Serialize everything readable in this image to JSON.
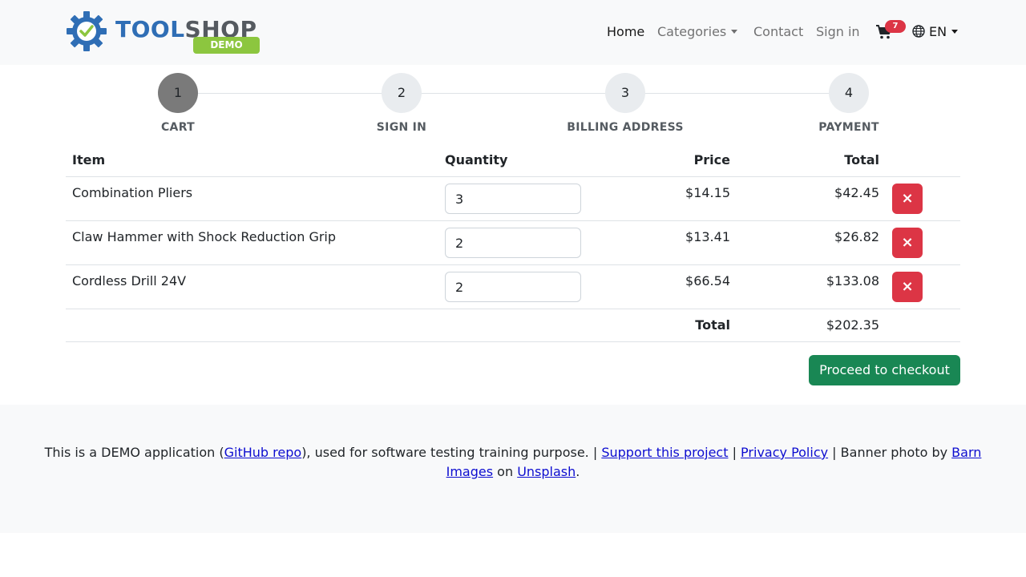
{
  "navbar": {
    "brand": {
      "word_part1": "TOOL",
      "word_part2": "SHOP",
      "badge": "DEMO"
    },
    "links": {
      "home": "Home",
      "categories": "Categories",
      "contact": "Contact",
      "sign_in": "Sign in"
    },
    "cart": {
      "icon": "cart-icon",
      "count": "7"
    },
    "language": {
      "icon": "globe-icon",
      "value": "EN"
    }
  },
  "stepper": {
    "steps": [
      {
        "number": "1",
        "label": "CART",
        "current": true
      },
      {
        "number": "2",
        "label": "SIGN IN",
        "current": false
      },
      {
        "number": "3",
        "label": "BILLING ADDRESS",
        "current": false
      },
      {
        "number": "4",
        "label": "PAYMENT",
        "current": false
      }
    ]
  },
  "cart_table": {
    "headers": {
      "item": "Item",
      "quantity": "Quantity",
      "price": "Price",
      "total": "Total"
    },
    "rows": [
      {
        "item": "Combination Pliers",
        "quantity": "3",
        "price": "$14.15",
        "total": "$42.45"
      },
      {
        "item": "Claw Hammer with Shock Reduction Grip",
        "quantity": "2",
        "price": "$13.41",
        "total": "$26.82"
      },
      {
        "item": "Cordless Drill 24V",
        "quantity": "2",
        "price": "$66.54",
        "total": "$133.08"
      }
    ],
    "delete_icon": "×",
    "summary": {
      "label": "Total",
      "value": "$202.35"
    }
  },
  "checkout_button": "Proceed to checkout",
  "footer": {
    "t1": "This is a DEMO application (",
    "github_link": "GitHub repo",
    "t2": "), used for software testing training purpose. | ",
    "support_link": "Support this project",
    "t3": " | ",
    "privacy_link": "Privacy Policy",
    "t4": " | Banner photo by ",
    "barn_link": "Barn Images",
    "t5": " on ",
    "unsplash_link": "Unsplash",
    "t6": "."
  },
  "colors": {
    "danger": "#dc3545",
    "success": "#198754",
    "brand_blue": "#2f6eb5",
    "brand_green": "#8cc63f"
  }
}
